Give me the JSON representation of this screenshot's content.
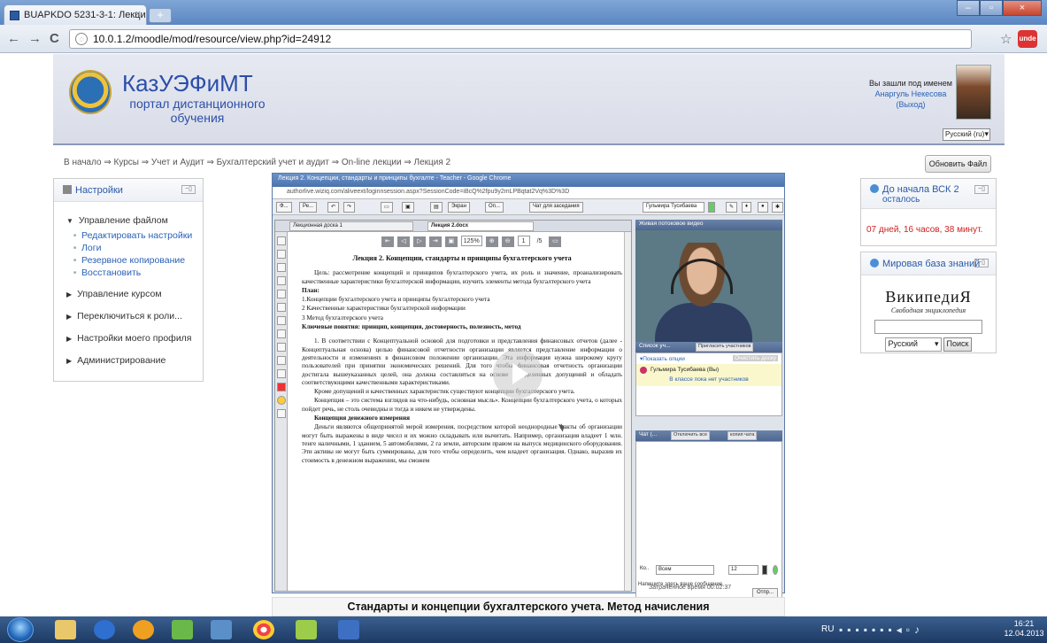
{
  "browser": {
    "tab_title": "BUAPKDO 5231-3-1: Лекци",
    "tab_close": "×",
    "new_tab": "+",
    "url": "10.0.1.2/moodle/mod/resource/view.php?id=24912",
    "back": "←",
    "forward": "→",
    "reload": "C",
    "star": "☆",
    "ext_label": "unde"
  },
  "header": {
    "site_name": "КазУЭФиМТ",
    "site_sub": "портал дистанционного обучения",
    "login_text": "Вы зашли под именем",
    "user_name": "Анаргуль Некесова",
    "logout": "(Выход)",
    "lang": "Русский (ru)"
  },
  "breadcrumb": "В начало ⇒ Курсы ⇒ Учет и Аудит ⇒ Бухгалтерский учет и аудит ⇒ On-line лекции ⇒ Лекция 2",
  "update_button": "Обновить Файл",
  "settings": {
    "title": "Настройки",
    "collapse": "−▯",
    "items": [
      {
        "label": "Управление файлом",
        "open": true
      },
      {
        "label": "Редактировать настройки"
      },
      {
        "label": "Логи"
      },
      {
        "label": "Резервное копирование"
      },
      {
        "label": "Восстановить"
      },
      {
        "label": "Управление курсом"
      },
      {
        "label": "Переключиться к роли..."
      },
      {
        "label": "Настройки моего профиля"
      },
      {
        "label": "Администрирование"
      }
    ]
  },
  "share": {
    "title": "Лекция 2. Концепции, стандарты и принципы бухгалте - Teacher - Google Chrome",
    "url": "authorlive.wiziq.com/aliveext/loginnsession.aspx?SessionCode=iBcQ%2fpu9y2mLPBqtat2Vq%3D%3D",
    "tools": [
      "Ф...",
      "Ре...",
      "Экран",
      "Оп...",
      "Чат для заседания"
    ],
    "presenter": "Гульмира Тусибаева",
    "doc_tab1": "Лекционная доска 1",
    "doc_tab2": "Лекция 2.docx",
    "zoom": "125%",
    "page": "1",
    "pages": "/5",
    "doc": {
      "title": "Лекция 2. Концепции, стандарты и принципы бухгалтерского учета",
      "goal": "Цель: рассмотрение концепций и принципов бухгалтерского учета, их роль и значение, проанализировать качественные характеристики бухгалтерской информации, изучить элементы метода бухгалтерского учета",
      "plan": "План:",
      "plan1": "1.Концепции бухгалтерского учета и принципы бухгалтерского учета",
      "plan2": "2 Качественные характеристики бухгалтерской информации",
      "plan3": "3 Метод бухгалтерского учета",
      "keywords": "Ключевые понятия: принцип, концепция, достоверность, полезность, метод",
      "para1": "1. В соответствии с Концептуальной основой для подготовки и представления финансовых отчетов (далее - Концептуальная основа) целью финансовой отчетности организации является представление информации о деятельности и изменениях в финансовом положении организации. Эта информация нужна широкому кругу пользователей при принятии экономических решений. Для того чтобы финансовая отчетность организации достигала вышеуказанных целей, она должна составляться на основе определенных допущений и обладать соответствующими качественными характеристиками.",
      "para2": "Кроме допущений и качественных характеристик существуют концепции бухгалтерского учета.",
      "para3": "Концепция – это система взглядов на что-нибудь, основная мысль». Концепции бухгалтерского учета, о которых пойдет речь, не столь очевидны и тогда и никем не утверждены.",
      "sub1": "Концепция денежного измерения",
      "para4": "Деньги являются общепринятой мерой измерения, посредством которой неоднородные факты об организации могут быть выражены в виде чисел и их можно складывать или вычитать. Например, организация владеет 1 млн. тенге наличными, 1 зданием, 5 автомобилями, 2 га земли, авторским правом на выпуск медицинского оборудования. Эти активы не могут быть суммированы, для того чтобы определить, чем владеет организация. Однако, выразив их стоимость в денежном выражении, мы сможем"
    },
    "video_title": "Живая потоковое видео",
    "plist_title": "Список уч...",
    "invite": "Пригласить участников",
    "show_options": "▾Показать опции",
    "clear": "Очистить доску",
    "participant": "Гульмира Тусибаева (Вы)",
    "no_participants": "В классе пока нет участников",
    "chat_title": "Чат (...",
    "chat_off": "Отключить все",
    "chat_copy": "копия чата",
    "chat_to": "Всем",
    "font_size": "12",
    "chat_hint": "Напишите здесь ваше сообщение.",
    "send": "Отпр...",
    "elapsed": "Затраченное время 00:02:37"
  },
  "timer": {
    "title": "До начала ВСК 2",
    "subtitle": "осталось",
    "value": "07 дней, 16 часов, 38 минут."
  },
  "wiki": {
    "title": "Мировая база знаний",
    "logo": "ВикипедиЯ",
    "tagline": "Свободная энциклопедия",
    "lang": "Русский",
    "search": "Поиск"
  },
  "bottom_title": "Стандарты и концепции бухгалтерского учета. Метод начисления",
  "taskbar": {
    "lang": "RU",
    "time": "16:21",
    "date": "12.04.2013"
  }
}
